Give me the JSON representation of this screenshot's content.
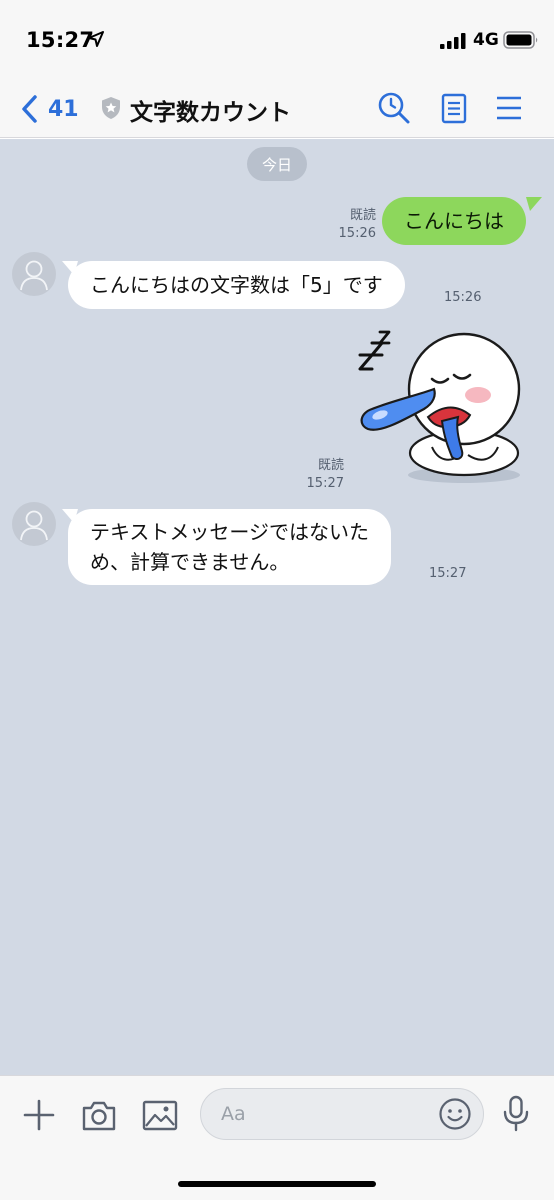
{
  "status_bar": {
    "time": "15:27",
    "network": "4G"
  },
  "header": {
    "back_count": "41",
    "title": "文字数カウント",
    "accent_color": "#2d6fd9"
  },
  "chat": {
    "date_label": "今日",
    "messages": [
      {
        "side": "right",
        "text": "こんにちは",
        "read": "既読",
        "time": "15:26"
      },
      {
        "side": "left",
        "text": "こんにちはの文字数は「5」です",
        "time": "15:26"
      },
      {
        "side": "right",
        "type": "sticker",
        "sticker": "sleeping-character-sticker",
        "read": "既読",
        "time": "15:27"
      },
      {
        "side": "left",
        "lines": [
          "テキストメッセージではないた",
          "め、計算できません。"
        ],
        "time": "15:27"
      }
    ]
  },
  "input_bar": {
    "placeholder": "Aa"
  },
  "icons": [
    "location-arrow-icon",
    "signal-icon",
    "battery-icon",
    "chevron-left-icon",
    "shield-icon",
    "search-icon",
    "notes-icon",
    "menu-icon",
    "avatar-icon",
    "plus-icon",
    "camera-icon",
    "image-icon",
    "emoji-icon",
    "microphone-icon"
  ]
}
